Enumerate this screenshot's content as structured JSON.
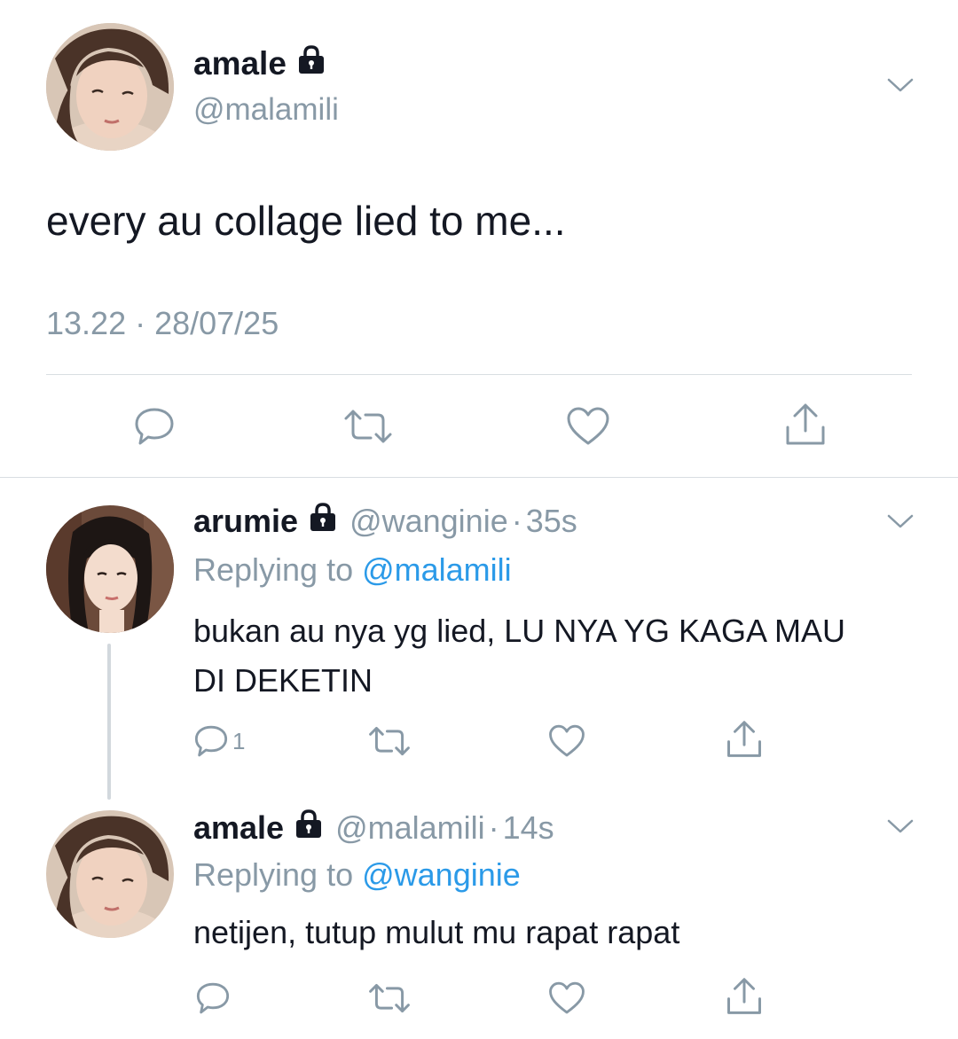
{
  "main_tweet": {
    "display_name": "amale",
    "handle": "@malamili",
    "text": "every au collage lied to me...",
    "timestamp": "13.22 · 28/07/25",
    "icons": [
      "lock-icon",
      "chevron-down-icon",
      "reply-icon",
      "retweet-icon",
      "like-icon",
      "share-icon"
    ]
  },
  "replies": [
    {
      "display_name": "arumie",
      "handle": "@wanginie",
      "time": "35s",
      "replying_prefix": "Replying to ",
      "replying_to": "@malamili",
      "text": "bukan au nya yg lied, LU NYA YG KAGA MAU DI DEKETIN",
      "reply_count": "1"
    },
    {
      "display_name": "amale",
      "handle": "@malamili",
      "time": "14s",
      "replying_prefix": "Replying to ",
      "replying_to": "@wanginie",
      "text": "netijen, tutup mulut mu rapat rapat",
      "reply_count": ""
    }
  ],
  "separator": "·",
  "colors": {
    "text": "#141823",
    "secondary": "#8899a6",
    "link": "#2b9ae8",
    "divider": "#d9dee2"
  }
}
